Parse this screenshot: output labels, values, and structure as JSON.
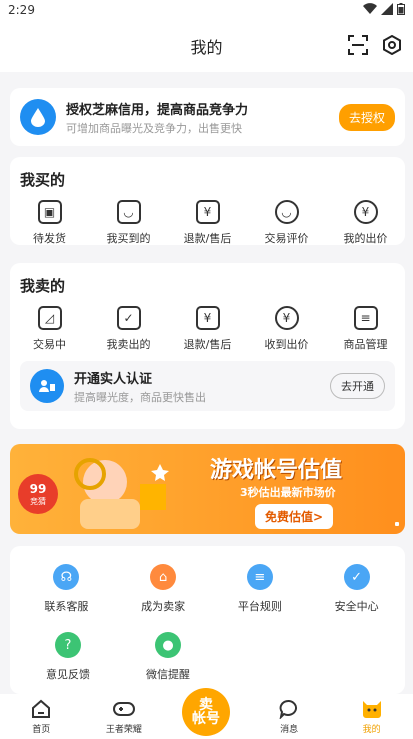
{
  "status_bar": {
    "time": "2:29"
  },
  "header": {
    "title": "我的"
  },
  "zhima": {
    "title": "授权芝麻信用，提高商品竞争力",
    "subtitle": "可增加商品曝光及竞争力，出售更快",
    "button": "去授权"
  },
  "buy_section": {
    "title": "我买的",
    "items": [
      {
        "label": "待发货",
        "icon": "box-icon"
      },
      {
        "label": "我买到的",
        "icon": "bag-icon"
      },
      {
        "label": "退款/售后",
        "icon": "refund-icon"
      },
      {
        "label": "交易评价",
        "icon": "comment-icon"
      },
      {
        "label": "我的出价",
        "icon": "bid-icon"
      }
    ]
  },
  "sell_section": {
    "title": "我卖的",
    "items": [
      {
        "label": "交易中",
        "icon": "trade-icon"
      },
      {
        "label": "我卖出的",
        "icon": "sold-icon"
      },
      {
        "label": "退款/售后",
        "icon": "refund-icon"
      },
      {
        "label": "收到出价",
        "icon": "bid-icon"
      },
      {
        "label": "商品管理",
        "icon": "manage-icon"
      }
    ],
    "verify": {
      "title": "开通实人认证",
      "subtitle": "提高曝光度，商品更快售出",
      "button": "去开通"
    }
  },
  "banner": {
    "badge_top": "99",
    "badge_bottom": "竞猜",
    "title": "游戏帐号估值",
    "subtitle": "3秒估出最新市场价",
    "button": "免费估值>"
  },
  "services": {
    "items": [
      {
        "label": "联系客服",
        "icon": "headset-icon",
        "color": "#4aa6f5"
      },
      {
        "label": "成为卖家",
        "icon": "store-icon",
        "color": "#ff8a3d"
      },
      {
        "label": "平台规则",
        "icon": "rules-icon",
        "color": "#4aa6f5"
      },
      {
        "label": "安全中心",
        "icon": "shield-icon",
        "color": "#4aa6f5"
      },
      {
        "label": "意见反馈",
        "icon": "feedback-icon",
        "color": "#3cc474"
      },
      {
        "label": "微信提醒",
        "icon": "wechat-icon",
        "color": "#3cc474"
      }
    ]
  },
  "tabbar": {
    "tabs": [
      {
        "label": "首页",
        "icon": "home-icon"
      },
      {
        "label": "王者荣耀",
        "icon": "gamepad-icon"
      },
      {
        "label": "消息",
        "icon": "message-icon"
      },
      {
        "label": "我的",
        "icon": "profile-icon",
        "active": true
      }
    ],
    "sell_button": "卖\n帐号"
  }
}
